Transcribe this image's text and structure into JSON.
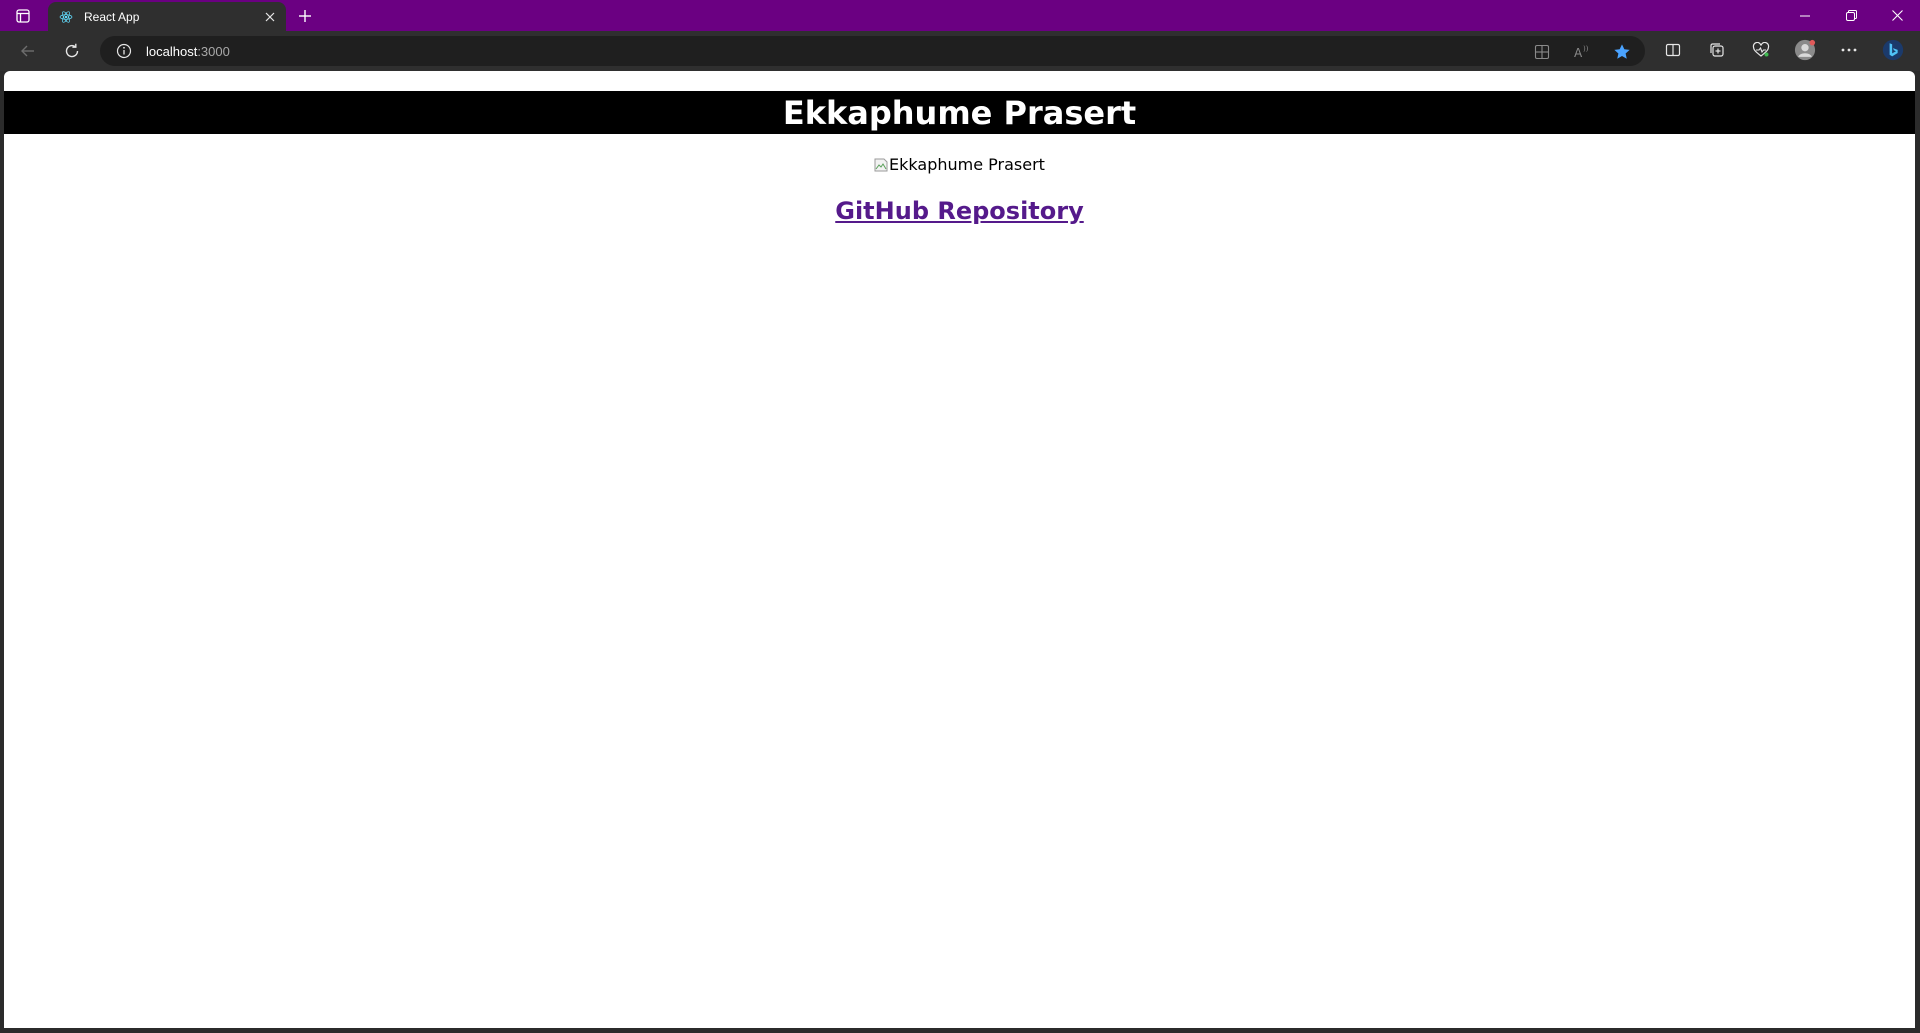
{
  "browser": {
    "tab": {
      "title": "React App",
      "favicon": "react-icon"
    },
    "address": {
      "host": "localhost",
      "port": ":3000"
    },
    "colors": {
      "frame": "#6b0082",
      "toolbar": "#2f2f2f",
      "favorite_star": "#4aa3ff"
    },
    "icons": [
      "tab-actions-icon",
      "close-icon",
      "new-tab-icon",
      "minimize-icon",
      "restore-icon",
      "window-close-icon",
      "back-icon",
      "refresh-icon",
      "info-icon",
      "app-available-icon",
      "read-aloud-icon",
      "favorite-star-icon",
      "split-screen-icon",
      "collections-icon",
      "browser-essentials-icon",
      "profile-avatar-icon",
      "more-options-icon",
      "copilot-icon"
    ]
  },
  "page": {
    "header_title": "Ekkaphume Prasert",
    "image_alt": "Ekkaphume Prasert",
    "repo_link_text": "GitHub Repository",
    "colors": {
      "header_bg": "#000000",
      "header_text": "#ffffff",
      "link": "#551a8b"
    }
  }
}
